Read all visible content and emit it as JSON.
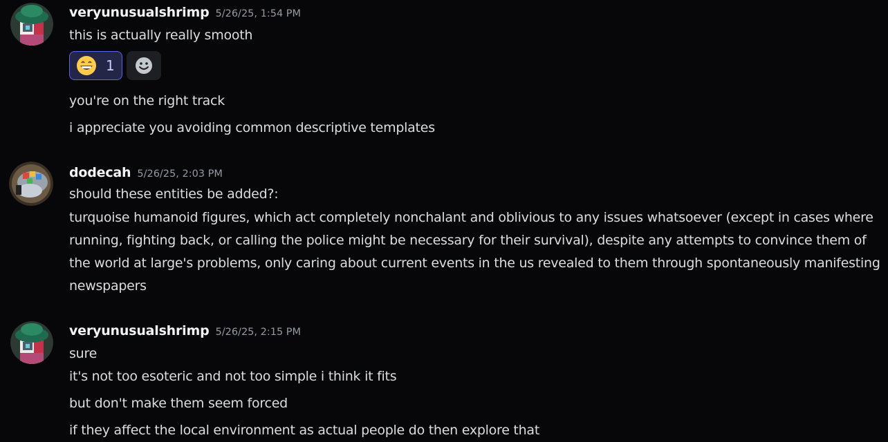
{
  "messages": [
    {
      "username": "veryunusualshrimp",
      "timestamp": "5/26/25, 1:54 PM",
      "lines": [
        "this is actually really smooth"
      ],
      "reactions": [
        {
          "emoji": "grinning-face-emoji",
          "count": "1"
        }
      ],
      "followups": [
        "you're on the right track",
        "i appreciate you avoiding common descriptive templates"
      ]
    },
    {
      "username": "dodecah",
      "timestamp": "5/26/25, 2:03 PM",
      "lines": [
        "should these entities be added?:",
        "turquoise humanoid figures, which act completely nonchalant and oblivious to any issues whatsoever (except in cases where running, fighting back, or calling the police might be necessary for their survival), despite any attempts to convince them of the world at large's problems, only caring about current events in the us revealed to them through spontaneously manifesting newspapers"
      ]
    },
    {
      "username": "veryunusualshrimp",
      "timestamp": "5/26/25, 2:15 PM",
      "lines": [
        "sure",
        "it's not too esoteric and not too simple i think it fits",
        "but don't make them seem forced",
        "if they affect the local environment as actual people do then explore that"
      ]
    }
  ],
  "colors": {
    "background": "#070709",
    "username": "#f2f3f5",
    "timestamp": "#949ba4",
    "text": "#dbdee1",
    "reaction_active_bg": "#232647",
    "reaction_active_border": "#5865f2",
    "reaction_count": "#c9cdfb"
  },
  "icons": {
    "add_reaction": "add-reaction-smiley-icon"
  }
}
